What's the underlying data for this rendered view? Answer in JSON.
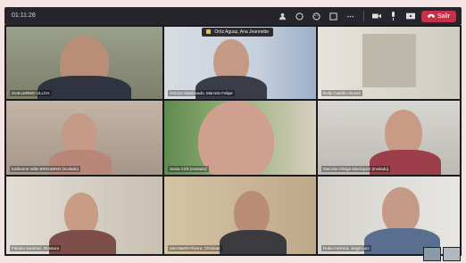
{
  "toolbar": {
    "timer": "01:11:28",
    "leave_label": "Salir",
    "icons": [
      "people-icon",
      "chat-icon",
      "reactions-icon",
      "rooms-icon",
      "more-icon",
      "camera-icon",
      "mic-icon",
      "share-icon",
      "leave-phone-icon"
    ]
  },
  "raised_hand": {
    "text": "Ortiz Aguaz, Ana Jeannette"
  },
  "participants": [
    {
      "name": "GUILLERMO ULLOA"
    },
    {
      "name": "Ortúzar Maldonado, Marcelo Felipe"
    },
    {
      "name": "Rolly Castillo Alvarez"
    },
    {
      "name": "Katherine Valle BRIGIDINO (Invitado)"
    },
    {
      "name": "Sonia Cirili (Invitado)"
    },
    {
      "name": "Marcela Ortega Manriquez (Invitado)"
    },
    {
      "name": "Fabiola Sanchez, Rosaura"
    },
    {
      "name": "San Martín Rivera, Christian"
    },
    {
      "name": "Rubio Herrera, Jorge Luis"
    }
  ],
  "colors": {
    "toolbar_bg": "#26252b",
    "leave_button": "#c4314b",
    "raised_hand": "#f1c232"
  }
}
